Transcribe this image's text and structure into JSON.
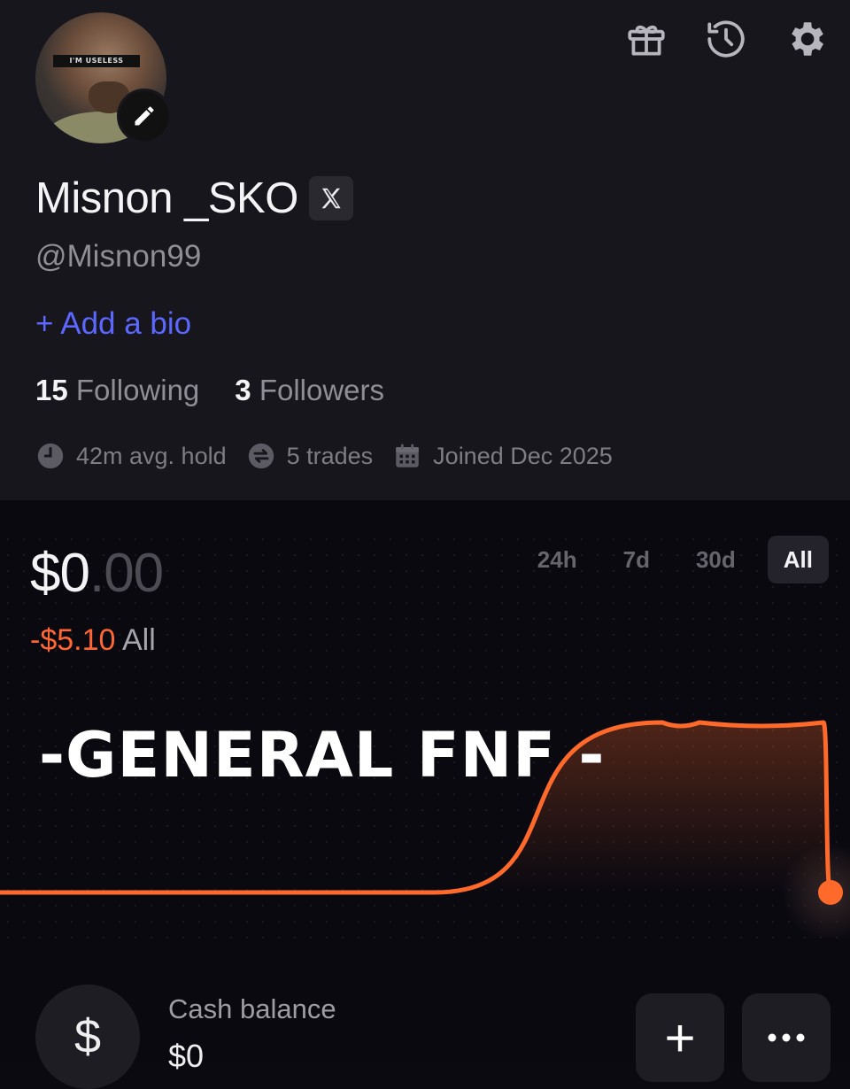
{
  "profile": {
    "avatar_band_text": "I'M USELESS",
    "name": "Misnon _SKO",
    "handle": "@Misnon99",
    "add_bio_label": "+ Add a bio",
    "following_count": "15",
    "following_label": "Following",
    "followers_count": "3",
    "followers_label": "Followers",
    "avg_hold": "42m avg. hold",
    "trades": "5 trades",
    "joined": "Joined Dec 2025"
  },
  "header_icons": [
    "gift-icon",
    "history-icon",
    "gear-icon"
  ],
  "portfolio": {
    "balance_int": "$0",
    "balance_dec": ".00",
    "pnl_value": "-$5.10",
    "pnl_period": "All",
    "ranges": [
      "24h",
      "7d",
      "30d",
      "All"
    ],
    "active_range": "All"
  },
  "overlay_text": "-GENERAL FNF -",
  "chart_data": {
    "type": "line",
    "title": "",
    "xlabel": "",
    "ylabel": "",
    "series": [
      {
        "values": [
          0,
          0,
          0,
          0,
          0,
          0,
          0,
          0,
          5.1,
          5.1,
          5.1,
          0
        ]
      }
    ],
    "color": "#ff6a2b"
  },
  "cash": {
    "icon_symbol": "$",
    "label": "Cash balance",
    "value": "$0",
    "plus_symbol": "+"
  },
  "colors": {
    "accent_blue": "#5b67ff",
    "loss_orange": "#ff6633"
  }
}
